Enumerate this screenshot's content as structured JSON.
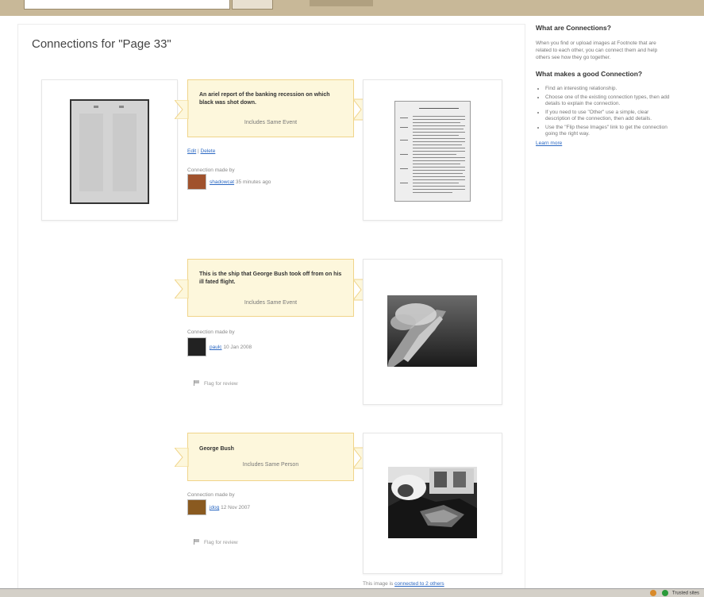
{
  "page": {
    "title": "Connections for \"Page 33\""
  },
  "sidebar": {
    "what_heading": "What are Connections?",
    "what_text": "When you find or upload images at Footnote that are related to each other, you can connect them and help others see how they go together.",
    "good_heading": "What makes a good Connection?",
    "tips": [
      "Find an interesting relationship.",
      "Choose one of the existing connection types, then add details to explain the connection.",
      "If you need to use \"Other\" use a simple, clear description of the connection, then add details.",
      "Use the \"Flip these Images\" link to get the connection going the right way."
    ],
    "learn_more": "Learn more"
  },
  "connections": [
    {
      "description": "An ariel report of the banking recession on which black was shot down.",
      "type": "Includes Same Event",
      "edit_label": "Edit",
      "delete_label": "Delete",
      "made_by_label": "Connection made by",
      "user": "shadowcat",
      "time": "35 minutes ago",
      "avatar_color": "#a0522d"
    },
    {
      "description": "This is the ship that George Bush took off from on his ill fated flight.",
      "type": "Includes Same Event",
      "made_by_label": "Connection made by",
      "user": "paulc",
      "time": "10 Jan 2008",
      "flag_label": "Flag for review",
      "avatar_color": "#222222"
    },
    {
      "description": "George Bush",
      "type": "Includes Same Person",
      "made_by_label": "Connection made by",
      "user": "jdog",
      "time": "12 Nov 2007",
      "flag_label": "Flag for review",
      "avatar_color": "#8a5a20"
    }
  ],
  "footer": {
    "connected_prefix": "This image is",
    "connected_link": "connected to 2 others"
  },
  "status_tray": {
    "text": "Trusted sites"
  },
  "colors": {
    "connection_box_bg": "#fdf7dc",
    "connection_box_border": "#f0d48a",
    "link": "#2c69c3"
  }
}
